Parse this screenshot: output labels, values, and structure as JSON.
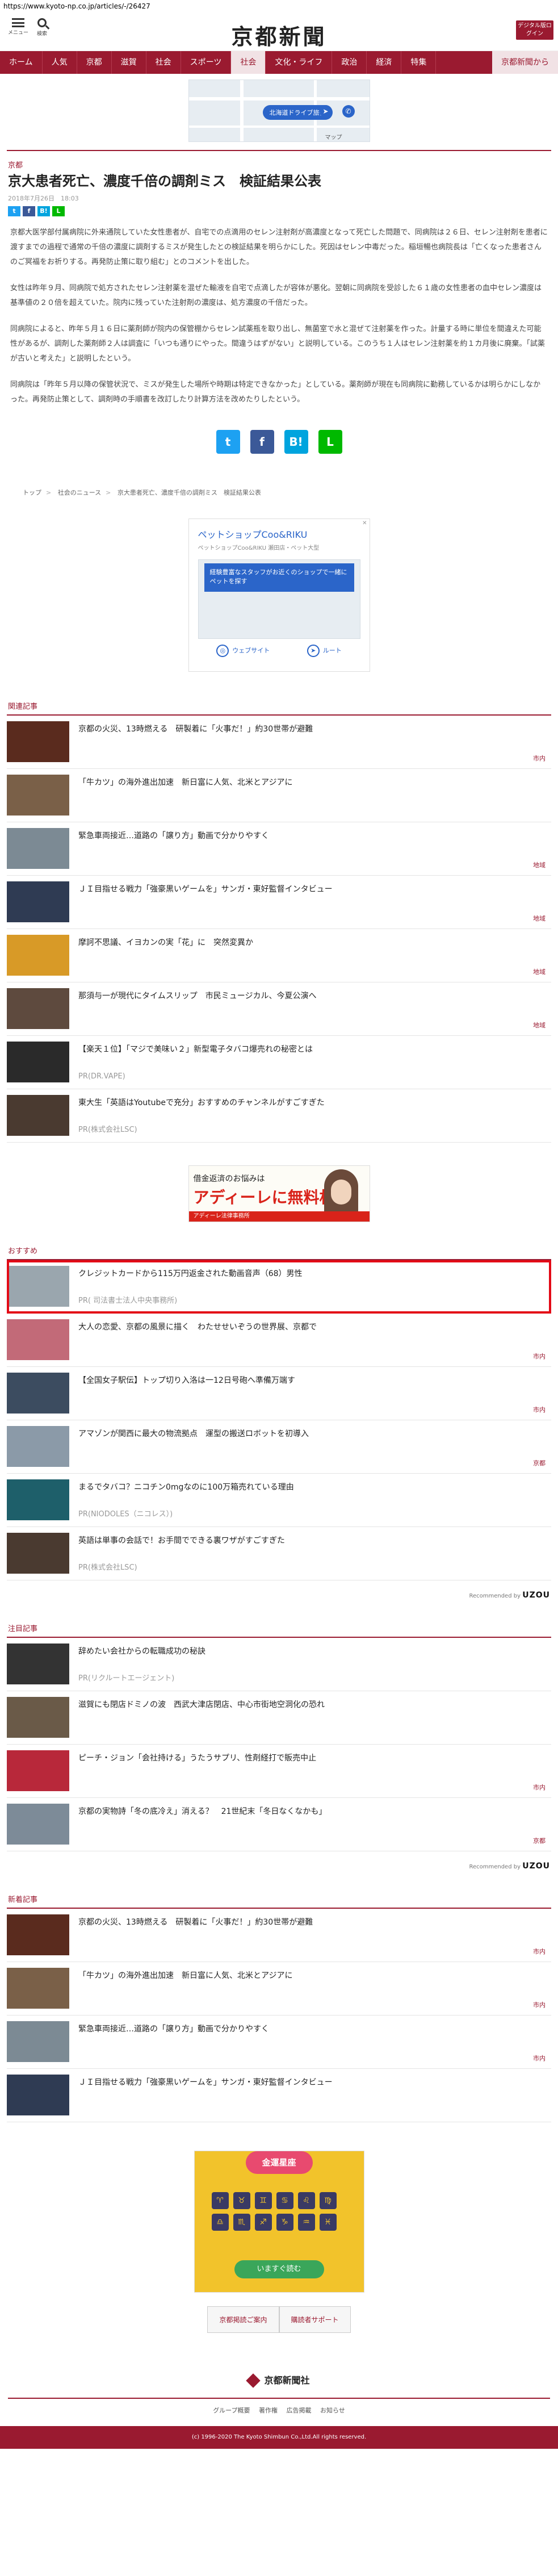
{
  "url": "https://www.kyoto-np.co.jp/articles/-/26427",
  "header": {
    "menu_label": "メニュー",
    "search_label": "検索",
    "logo": "京都新聞",
    "digital_button": "デジタル版ログイン"
  },
  "nav": [
    "ホーム",
    "人気",
    "京都",
    "滋賀",
    "社会",
    "スポーツ",
    "社会",
    "文化・ライフ",
    "政治",
    "経済",
    "特集",
    "京都新聞から"
  ],
  "nav_active_index": 6,
  "ad_top": {
    "cta": "北海道ドライブ旅行",
    "map_label": "マップ"
  },
  "article": {
    "category": "京都",
    "title": "京大患者死亡、濃度千倍の調剤ミス　検証結果公表",
    "date": "2018年7月26日　18:03",
    "share_small": [
      "t",
      "f",
      "B!",
      "L"
    ],
    "paragraphs": [
      "京都大医学部付属病院に外来通院していた女性患者が、自宅での点滴用のセレン注射剤が高濃度となって死亡した問題で、同病院は２６日、セレン注射剤を患者に渡すまでの過程で通常の千倍の濃度に調剤するミスが発生したとの検証結果を明らかにした。死因はセレン中毒だった。稲垣暢也病院長は「亡くなった患者さんのご冥福をお祈りする。再発防止策に取り組む」とのコメントを出した。",
      "女性は昨年９月、同病院で処方されたセレン注射薬を混ぜた輸液を自宅で点滴したが容体が悪化。翌朝に同病院を受診した６１歳の女性患者の血中セレン濃度は基準値の２０倍を超えていた。院内に残っていた注射剤の濃度は、処方濃度の千倍だった。",
      "同病院によると、昨年５月１６日に薬剤師が院内の保管棚からセレン試薬瓶を取り出し、無菌室で水と混ぜて注射薬を作った。計量する時に単位を間違えた可能性があるが、調剤した薬剤師２人は調査に「いつも通りにやった。間違うはずがない」と説明している。このうち１人はセレン注射薬を約１カ月後に廃棄。「試薬が古いと考えた」と説明したという。",
      "同病院は「昨年５月以降の保管状況で、ミスが発生した場所や時期は特定できなかった」としている。薬剤師が現在も同病院に勤務しているかは明らかにしなかった。再発防止策として、調剤時の手順書を改訂したり計算方法を改めたりしたという。"
    ],
    "share_big": [
      "t",
      "f",
      "B!",
      "L"
    ]
  },
  "breadcrumb": [
    "トップ",
    "社会のニュース",
    "京大患者死亡、濃度千倍の調剤ミス　検証結果公表"
  ],
  "ad_pet": {
    "title": "ペットショップCoo&RIKU",
    "subtitle": "ペットショップCoo&RIKU 瀬田店・ペット大型",
    "box": "経験豊富なスタッフがお近くのショップで一緒にペットを探す",
    "website": "ウェブサイト",
    "route": "ルート",
    "close": "✕"
  },
  "related": {
    "title": "関連記事",
    "items": [
      {
        "title": "京都の火災、13時燃える　研製着に「火事だ！」約30世帯が避難",
        "tag": "市内",
        "pr": "",
        "color": "#5a2b1e"
      },
      {
        "title": "「牛カツ」の海外進出加速　新日富に人気、北米とアジアに",
        "tag": "",
        "pr": "",
        "color": "#7a6048"
      },
      {
        "title": "緊急車両接近…道路の「譲り方」動画で分かりやすく",
        "tag": "地域",
        "pr": "",
        "color": "#7c8a94"
      },
      {
        "title": "ＪＩ目指せる戦力「強豪黒いゲームを」サンガ・東好監督インタビュー",
        "tag": "地域",
        "pr": "",
        "color": "#2f3b53"
      },
      {
        "title": "摩訶不思議、イヨカンの実「花」に　突然変異か",
        "tag": "地域",
        "pr": "",
        "color": "#d89a27"
      },
      {
        "title": "那須与一が現代にタイムスリップ　市民ミュージカル、今夏公演へ",
        "tag": "地域",
        "pr": "",
        "color": "#5e4a3e"
      },
      {
        "title": "【楽天１位】「マジで美味い２」新型電子タバコ爆売れの秘密とは",
        "tag": "",
        "pr": "PR(DR.VAPE)",
        "color": "#2a2a2a"
      },
      {
        "title": "東大生「英語はYoutubeで充分」おすすめのチャンネルがすごすぎた",
        "tag": "",
        "pr": "PR(株式会社LSC)",
        "color": "#4a3a30"
      }
    ]
  },
  "ad_loan": {
    "line1": "借金返済のお悩みは",
    "line2": "アディーレに無料相談",
    "line3": "アディーレ法律事務所"
  },
  "recommend": {
    "title": "おすすめ",
    "items": [
      {
        "title": "クレジットカードから115万円返金された動画音声（68）男性",
        "tag": "",
        "pr": "PR( 司法書士法人中央事務所)",
        "color": "#9aa6ae",
        "highlight": true
      },
      {
        "title": "大人の恋愛、京都の風景に描く　わたせせいぞうの世界展、京都で",
        "tag": "市内",
        "pr": "",
        "color": "#c26a78",
        "highlight": false
      },
      {
        "title": "【全国女子駅伝】トップ切り入洛は一12日号砲へ準備万端す",
        "tag": "市内",
        "pr": "",
        "color": "#3c4c60",
        "highlight": false
      },
      {
        "title": "アマゾンが関西に最大の物流拠点　運型の搬送ロボットを初導入",
        "tag": "京都",
        "pr": "",
        "color": "#8b9aa8",
        "highlight": false
      },
      {
        "title": "まるでタバコ？ニコチン0mgなのに100万箱売れている理由",
        "tag": "",
        "pr": "PR(NIODOLES（ニコレス）)",
        "color": "#1e5f6a",
        "highlight": false
      },
      {
        "title": "英語は単事の会話で！お手間でできる裏ワザがすごすぎた",
        "tag": "",
        "pr": "PR(株式会社LSC)",
        "color": "#4a3a30",
        "highlight": false
      }
    ],
    "powered_prefix": "Recommended by",
    "powered_brand": "UZOU"
  },
  "attention": {
    "title": "注目記事",
    "items": [
      {
        "title": "辞めたい会社からの転職成功の秘訣",
        "tag": "",
        "pr": "PR(リクルートエージェント)",
        "color": "#333"
      },
      {
        "title": "滋賀にも閉店ドミノの波　西武大津店閉店、中心市街地空洞化の恐れ",
        "tag": "",
        "pr": "",
        "color": "#6a5a48"
      },
      {
        "title": "ピーチ・ジョン「会社持ける」うたうサプリ、性剤経打で販売中止",
        "tag": "市内",
        "pr": "",
        "color": "#b8283a"
      },
      {
        "title": "京都の実物詩「冬の底冷え」消える？　21世紀末「冬日なくなかも」",
        "tag": "京都",
        "pr": "",
        "color": "#7d8b98"
      }
    ],
    "powered_prefix": "Recommended by",
    "powered_brand": "UZOU"
  },
  "latest": {
    "title": "新着記事",
    "items": [
      {
        "title": "京都の火災、13時燃える　研製着に「火事だ！」約30世帯が避難",
        "tag": "市内",
        "pr": "",
        "color": "#5a2b1e"
      },
      {
        "title": "「牛カツ」の海外進出加速　新日富に人気、北米とアジアに",
        "tag": "市内",
        "pr": "",
        "color": "#7a6048"
      },
      {
        "title": "緊急車両接近…道路の「譲り方」動画で分かりやすく",
        "tag": "市内",
        "pr": "",
        "color": "#7c8a94"
      },
      {
        "title": "ＪＩ目指せる戦力「強豪黒いゲームを」サンガ・東好監督インタビュー",
        "tag": "",
        "pr": "",
        "color": "#2f3b53"
      }
    ]
  },
  "ad_zodiac": {
    "head": "金運星座",
    "cta": "いますぐ読む",
    "signs": [
      "♈",
      "♉",
      "♊",
      "♋",
      "♌",
      "♍",
      "♎",
      "♏",
      "♐",
      "♑",
      "♒",
      "♓"
    ]
  },
  "footer": {
    "buttons": [
      "京都掲読ご案内",
      "購読者サポート"
    ],
    "logo": "京都新聞社",
    "links": [
      "グループ概要",
      "著作権",
      "広告掲載",
      "お知らせ"
    ],
    "copyright": "(c) 1996-2020 The Kyoto Shimbun Co.,Ltd.All rights reserved."
  },
  "colors": {
    "brand": "#9a1a30",
    "highlight": "#e30b17"
  }
}
